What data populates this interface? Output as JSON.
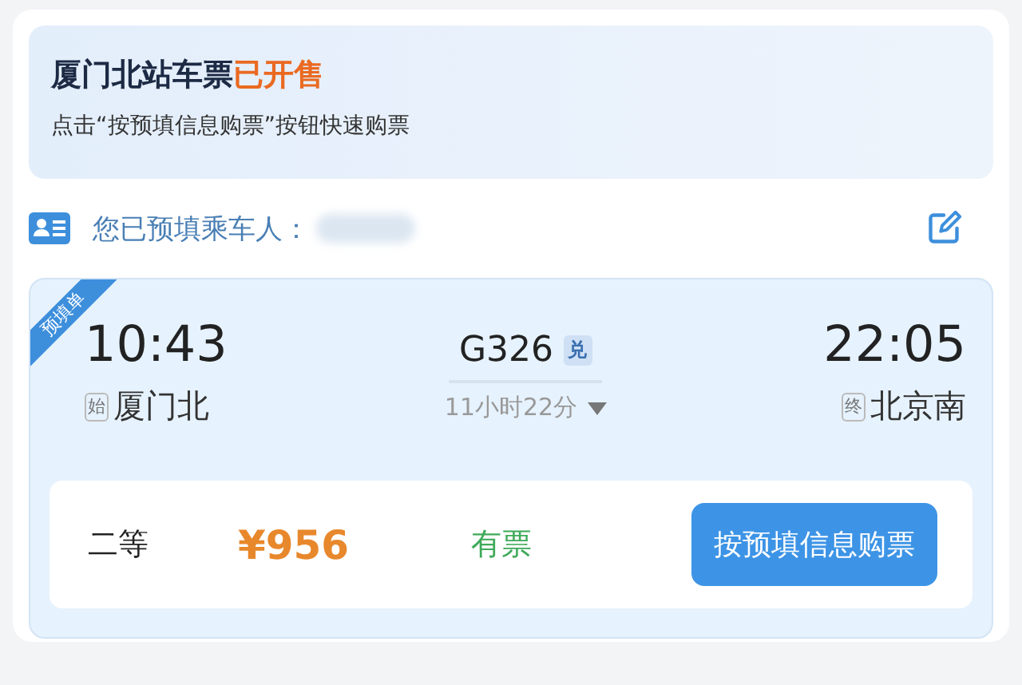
{
  "banner": {
    "title": "厦门北站车票",
    "title_highlight": "已开售",
    "subtitle": "点击“按预填信息购票”按钮快速购票"
  },
  "passenger": {
    "label": "您已预填乘车人：",
    "name_blurred": true
  },
  "ticket": {
    "ribbon": "预填单",
    "depart_time": "10:43",
    "depart_tag": "始",
    "depart_station": "厦门北",
    "train": "G326",
    "train_badge": "兑",
    "duration": "11小时22分",
    "arrive_time": "22:05",
    "arrive_tag": "终",
    "arrive_station": "北京南",
    "seat": {
      "class": "二等",
      "price": "¥956",
      "availability": "有票",
      "button": "按预填信息购票"
    }
  }
}
